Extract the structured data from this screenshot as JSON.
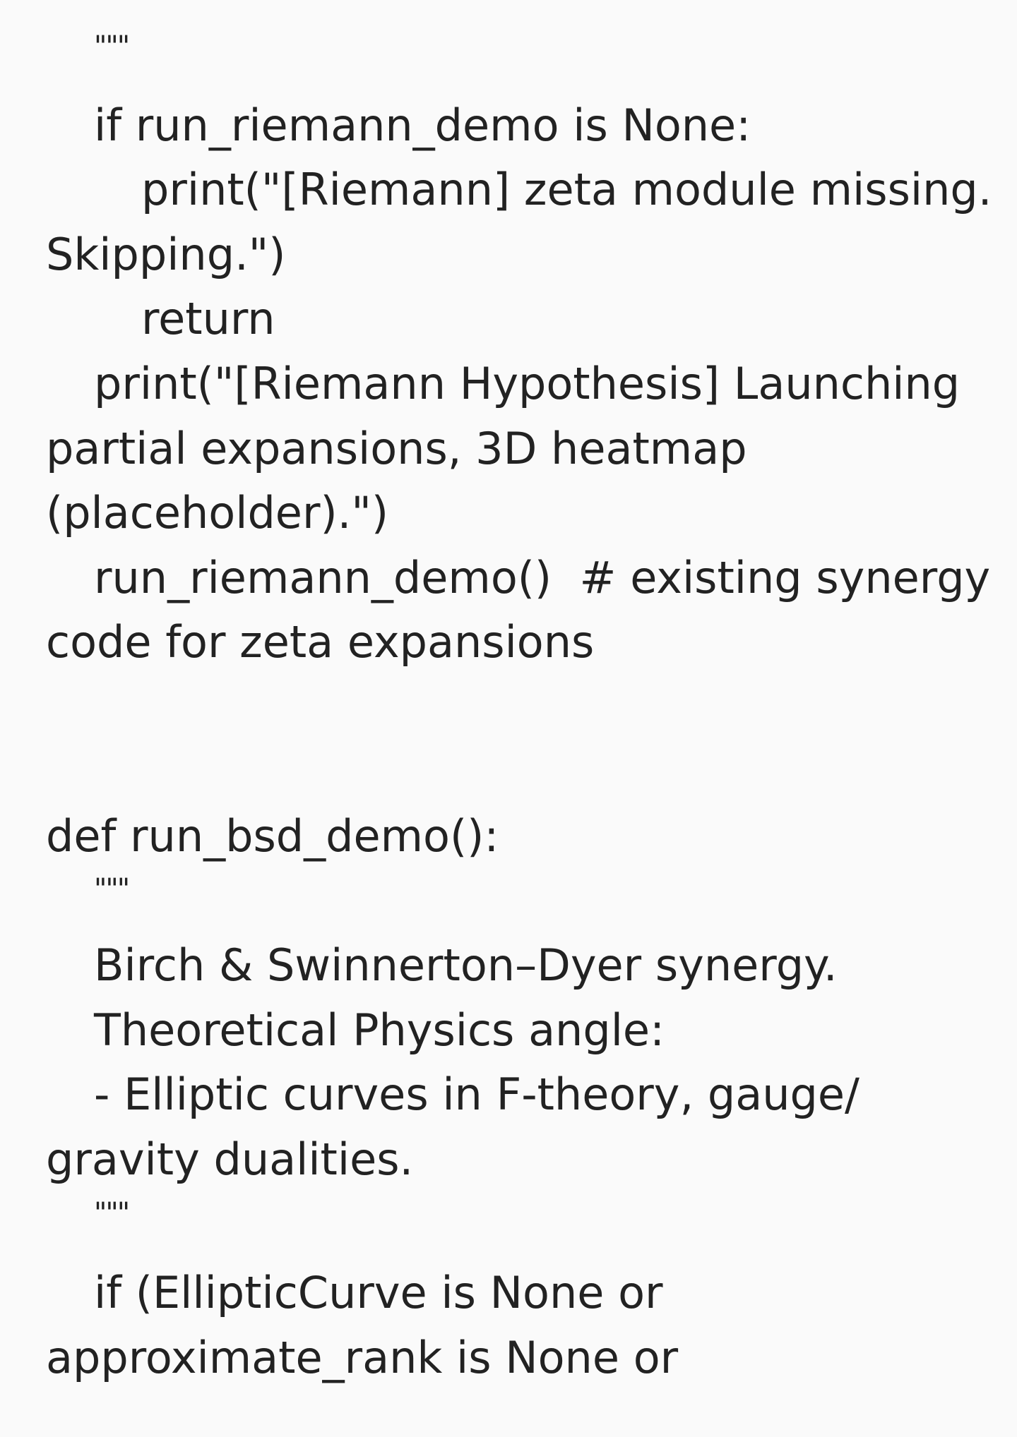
{
  "document": {
    "lines": [
      "\"\"\"",
      "if run_riemann_demo is None:",
      "print(\"[Riemann] zeta module missing.",
      "Skipping.\")",
      "return",
      "print(\"[Riemann Hypothesis] Launching",
      "partial expansions, 3D heatmap",
      "(placeholder).\")",
      "run_riemann_demo()  # existing synergy",
      "code for zeta expansions",
      "def run_bsd_demo():",
      "\"\"\"",
      "Birch & Swinnerton–Dyer synergy.",
      "Theoretical Physics angle:",
      "- Elliptic curves in F-theory, gauge/",
      "gravity dualities.",
      "\"\"\"",
      "if (EllipticCurve is None or",
      "approximate_rank is None or"
    ]
  }
}
